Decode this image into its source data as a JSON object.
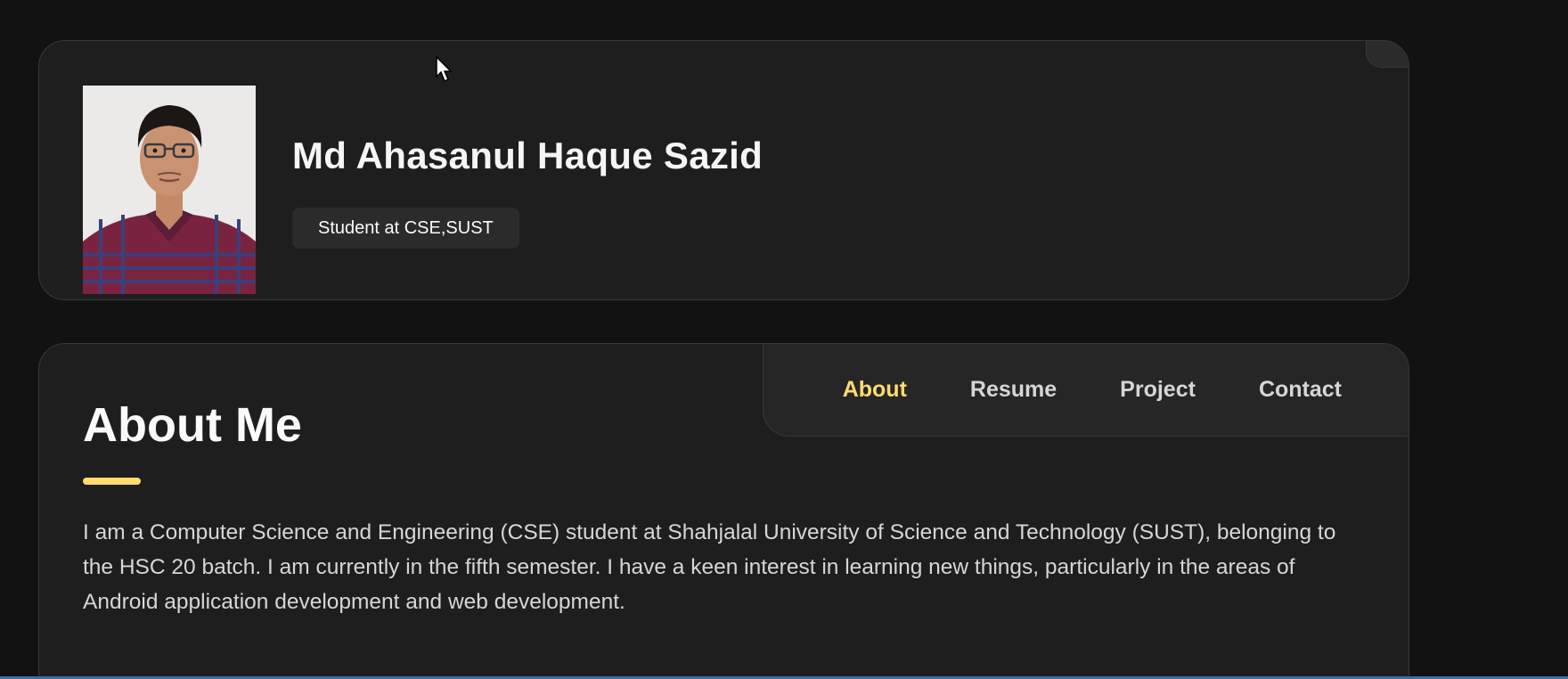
{
  "profile": {
    "name": "Md Ahasanul Haque Sazid",
    "title": "Student at CSE,SUST"
  },
  "nav": {
    "items": [
      {
        "label": "About",
        "active": true
      },
      {
        "label": "Resume",
        "active": false
      },
      {
        "label": "Project",
        "active": false
      },
      {
        "label": "Contact",
        "active": false
      }
    ]
  },
  "about": {
    "heading": "About Me",
    "paragraph": "I am a Computer Science and Engineering (CSE) student at Shahjalal University of Science and Technology (SUST), belonging to the HSC 20 batch. I am currently in the fifth semester. I have a keen interest in learning new things, particularly in the areas of Android application development and web development."
  },
  "colors": {
    "accent": "#ffdb70",
    "background": "#121212",
    "card": "#1e1e1f"
  }
}
